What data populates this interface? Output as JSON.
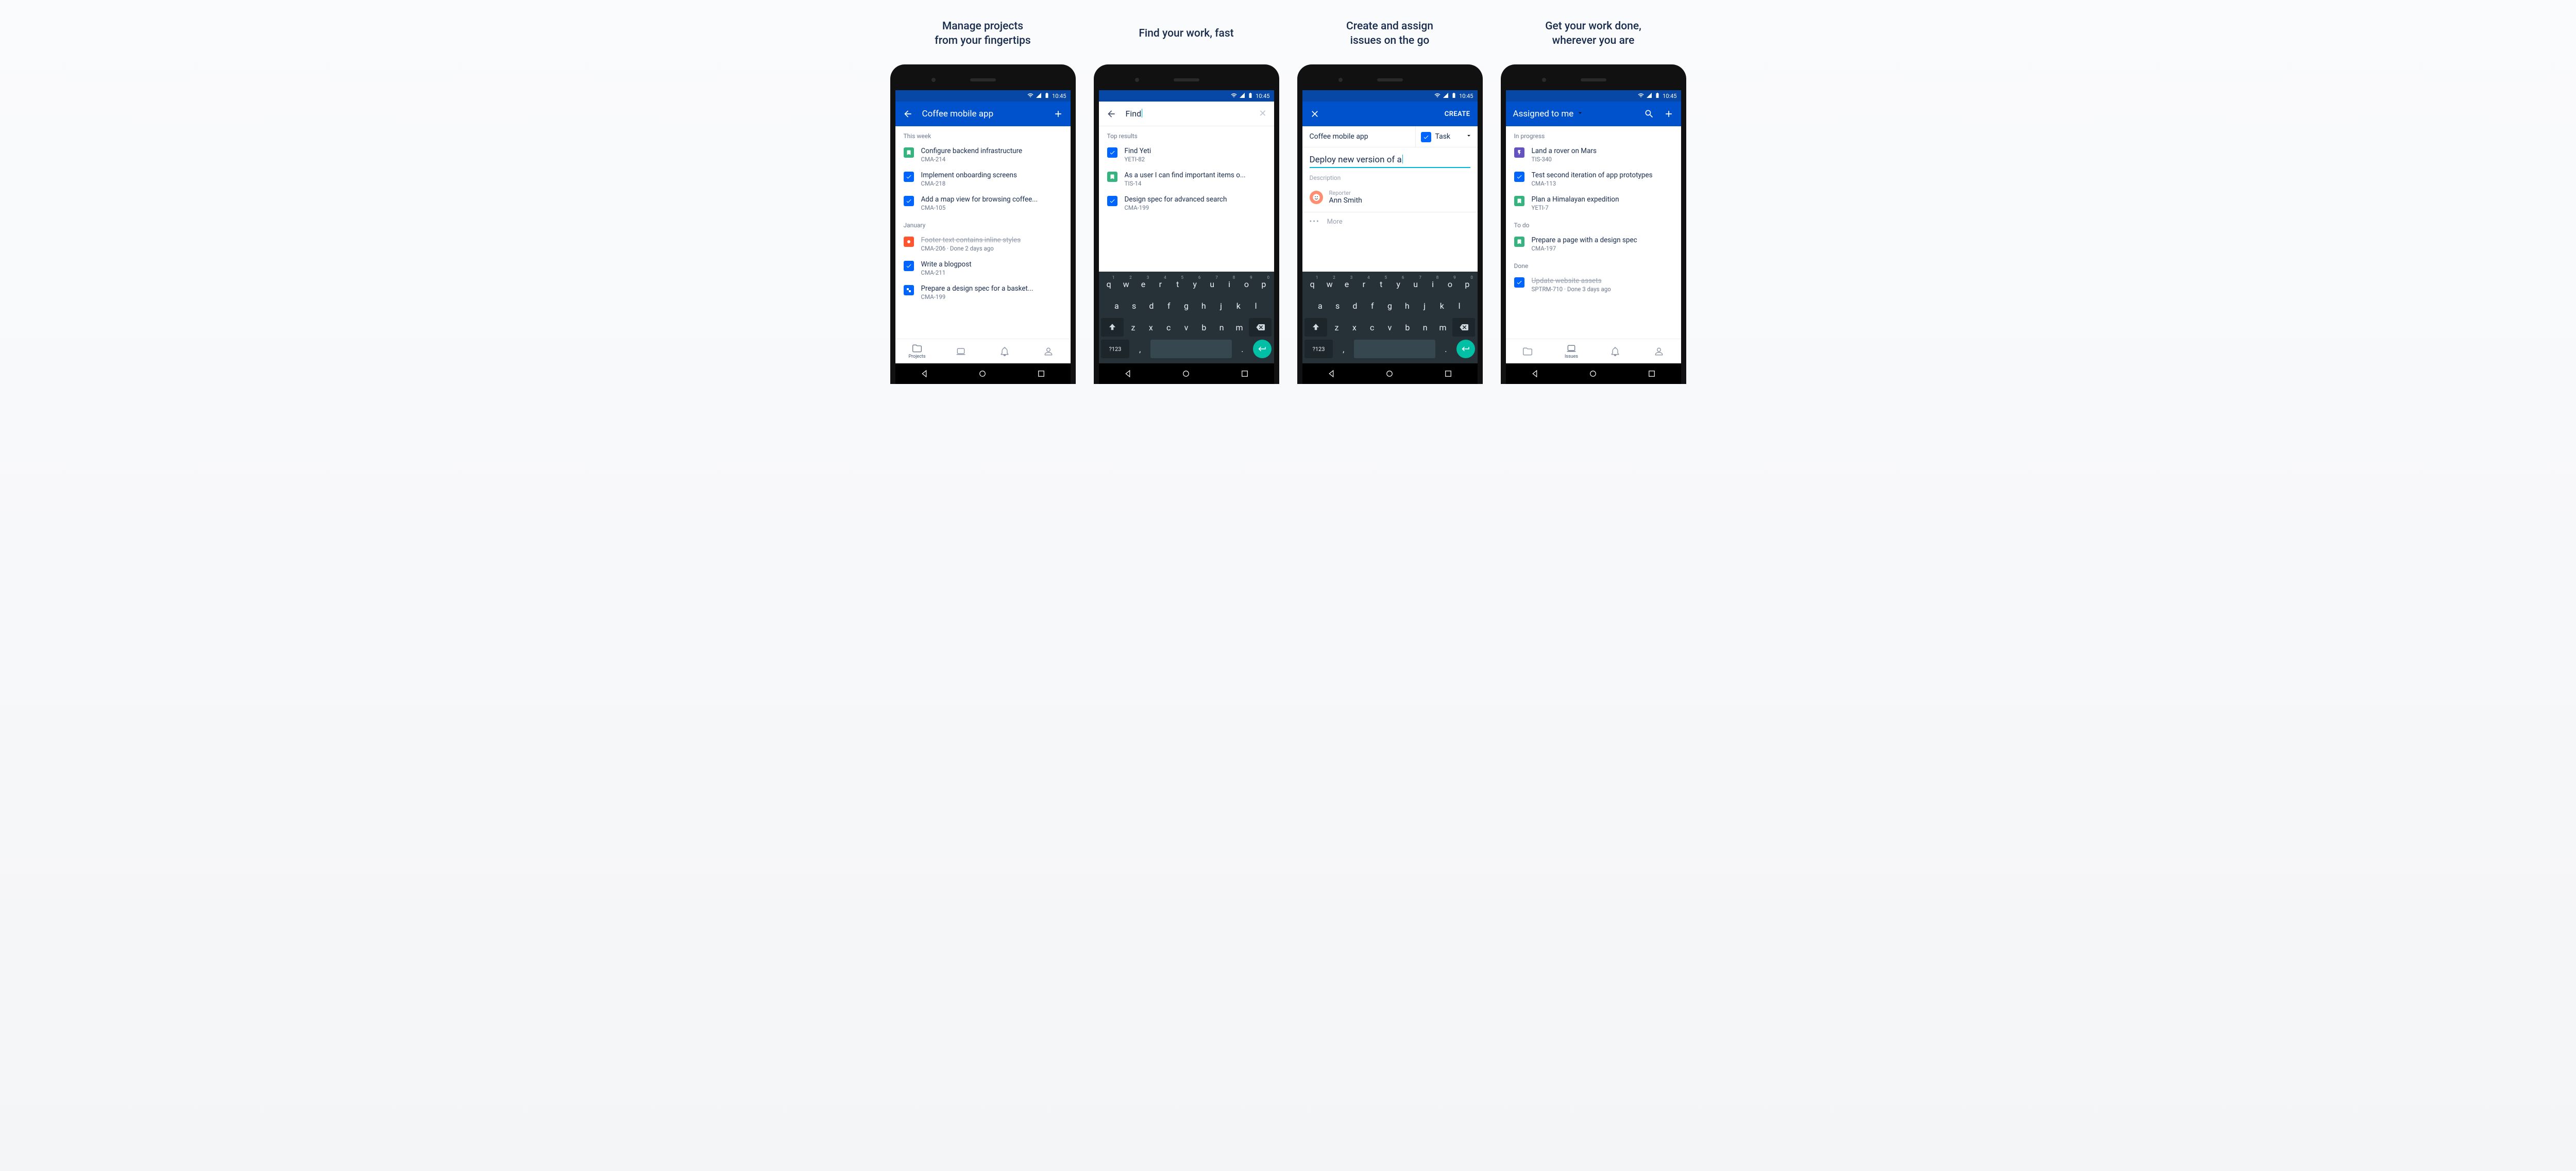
{
  "status_time": "10:45",
  "captions": [
    "Manage projects\nfrom your fingertips",
    "Find your work, fast",
    "Create and assign\nissues on the go",
    "Get your work done,\nwherever you are"
  ],
  "screen1": {
    "title": "Coffee mobile app",
    "sections": [
      {
        "label": "This week",
        "items": [
          {
            "icon": "story",
            "title": "Configure backend infrastructure",
            "sub": "CMA-214"
          },
          {
            "icon": "task",
            "title": "Implement onboarding screens",
            "sub": "CMA-218"
          },
          {
            "icon": "task",
            "title": "Add a map view for browsing coffee...",
            "sub": "CMA-105"
          }
        ]
      },
      {
        "label": "January",
        "items": [
          {
            "icon": "bug",
            "title": "Footer text contains inline styles",
            "sub": "CMA-206 · Done 2 days ago",
            "struck": true
          },
          {
            "icon": "task",
            "title": "Write a blogpost",
            "sub": "CMA-211"
          },
          {
            "icon": "subtask",
            "title": "Prepare a design spec for a basket...",
            "sub": "CMA-199"
          }
        ]
      }
    ],
    "active_tab_label": "Projects"
  },
  "screen2": {
    "query": "Find",
    "section_label": "Top results",
    "items": [
      {
        "icon": "task",
        "title": "Find Yeti",
        "sub": "YETI-82"
      },
      {
        "icon": "story",
        "title": "As a user I can find important items o...",
        "sub": "TIS-14"
      },
      {
        "icon": "task",
        "title": "Design spec for advanced search",
        "sub": "CMA-199"
      }
    ]
  },
  "screen3": {
    "action": "CREATE",
    "project": "Coffee mobile app",
    "type": "Task",
    "summary": "Deploy new version of a",
    "description_label": "Description",
    "reporter_label": "Reporter",
    "reporter_name": "Ann Smith",
    "more_label": "More"
  },
  "screen4": {
    "title": "Assigned to me",
    "sections": [
      {
        "label": "In progress",
        "items": [
          {
            "icon": "epic",
            "title": "Land a rover on Mars",
            "sub": "TIS-340"
          },
          {
            "icon": "task",
            "title": "Test second iteration of app prototypes",
            "sub": "CMA-113"
          },
          {
            "icon": "story",
            "title": "Plan a Himalayan expedition",
            "sub": "YETI-7"
          }
        ]
      },
      {
        "label": "To do",
        "items": [
          {
            "icon": "story",
            "title": "Prepare a page with a design spec",
            "sub": "CMA-197"
          }
        ]
      },
      {
        "label": "Done",
        "items": [
          {
            "icon": "task",
            "title": "Update website assets",
            "sub": "SPTRM-710 · Done 3 days ago",
            "struck": true
          }
        ]
      }
    ],
    "active_tab_label": "Issues"
  },
  "keyboard": {
    "row1": [
      "q",
      "w",
      "e",
      "r",
      "t",
      "y",
      "u",
      "i",
      "o",
      "p"
    ],
    "row1_sup": [
      "1",
      "2",
      "3",
      "4",
      "5",
      "6",
      "7",
      "8",
      "9",
      "0"
    ],
    "row2": [
      "a",
      "s",
      "d",
      "f",
      "g",
      "h",
      "j",
      "k",
      "l"
    ],
    "row3": [
      "z",
      "x",
      "c",
      "v",
      "b",
      "n",
      "m"
    ],
    "fn123": "?123",
    "comma": ",",
    "period": "."
  },
  "nav_tabs": [
    "Projects",
    "Issues",
    "Notifications",
    "Account"
  ]
}
